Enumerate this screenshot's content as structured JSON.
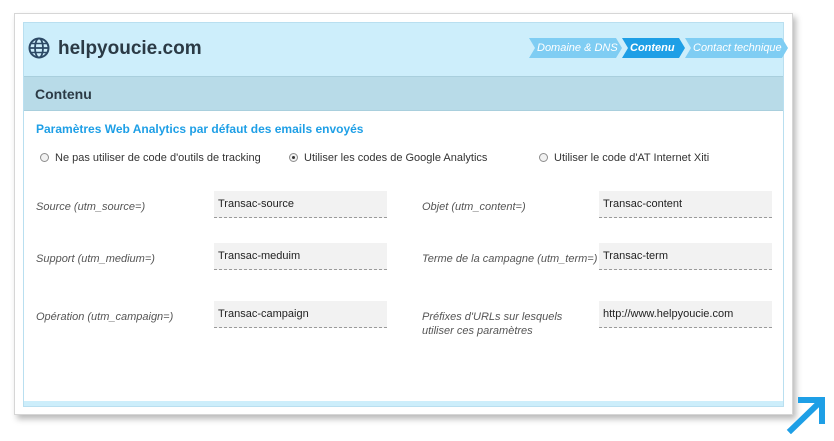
{
  "header": {
    "site_title": "helpyoucie.com",
    "icon": "globe-icon"
  },
  "steps": [
    {
      "label": "Domaine & DNS",
      "active": false
    },
    {
      "label": "Contenu",
      "active": true
    },
    {
      "label": "Contact technique",
      "active": false
    }
  ],
  "section": {
    "title": "Contenu",
    "subtitle": "Paramètres Web Analytics par défaut des emails envoyés"
  },
  "tracking_options": [
    {
      "label": "Ne pas utiliser de code d'outils de tracking",
      "selected": false
    },
    {
      "label": "Utiliser les codes de Google Analytics",
      "selected": true
    },
    {
      "label": "Utiliser le code d'AT Internet Xiti",
      "selected": false
    }
  ],
  "fields": {
    "source": {
      "label": "Source (utm_source=)",
      "value": "Transac-source"
    },
    "content": {
      "label": "Objet (utm_content=)",
      "value": "Transac-content"
    },
    "medium": {
      "label": "Support (utm_medium=)",
      "value": "Transac-meduim"
    },
    "term": {
      "label": "Terme de la campagne (utm_term=)",
      "value": "Transac-term"
    },
    "campaign": {
      "label": "Opération (utm_campaign=)",
      "value": "Transac-campaign"
    },
    "url_prefix": {
      "label": "Préfixes d'URLs sur lesquels utiliser ces paramètres",
      "value": "http://www.helpyoucie.com"
    }
  },
  "colors": {
    "accent": "#1e9fe6",
    "step_inactive": "#7fcdf3",
    "panel_bg": "#cdeefb",
    "section_bg": "#b8dbe8"
  }
}
